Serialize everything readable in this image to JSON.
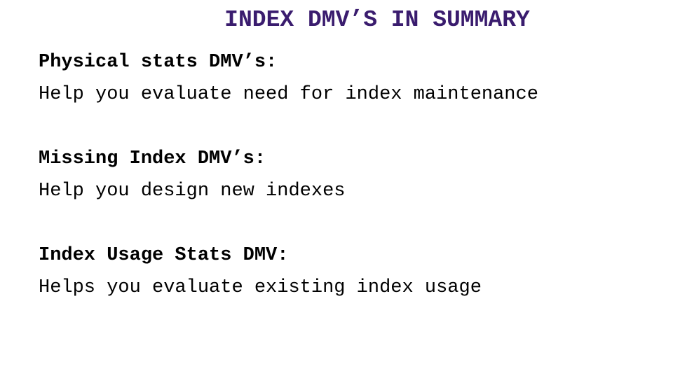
{
  "title": "INDEX DMV’S IN SUMMARY",
  "colors": {
    "title": "#3a1c6e",
    "text": "#000000"
  },
  "sections": [
    {
      "heading": "Physical stats DMV’s:",
      "description": "Help you evaluate need for index maintenance"
    },
    {
      "heading": "Missing Index DMV’s:",
      "description": "Help you design new indexes"
    },
    {
      "heading": "Index Usage Stats DMV:",
      "description": "Helps you evaluate existing index usage"
    }
  ]
}
